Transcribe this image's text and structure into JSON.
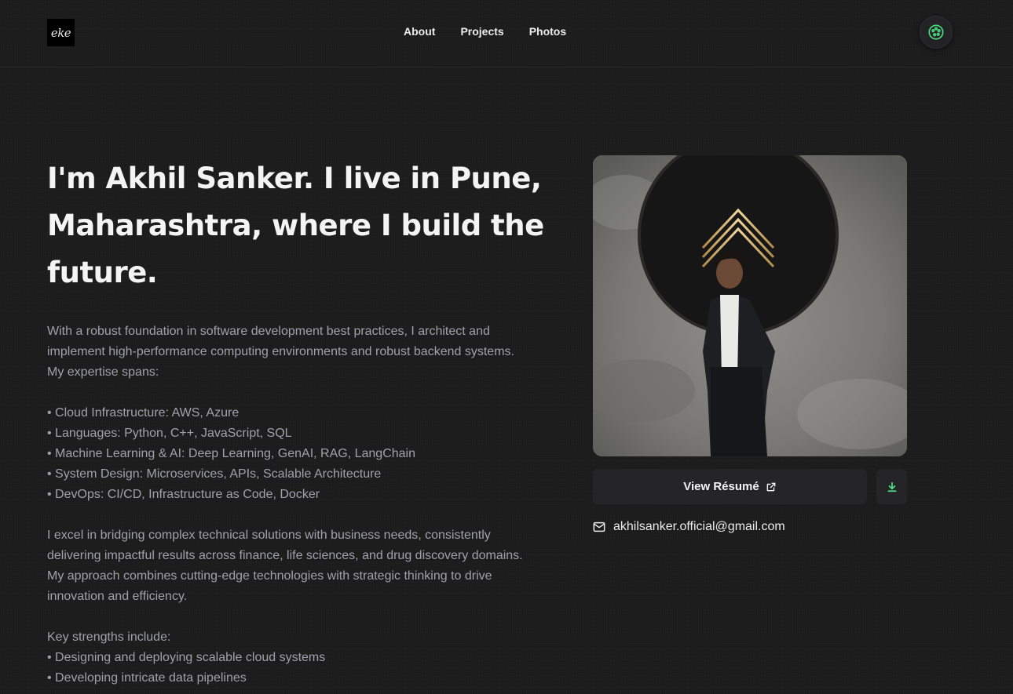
{
  "header": {
    "logo_text": "eke",
    "nav": [
      {
        "label": "About"
      },
      {
        "label": "Projects"
      },
      {
        "label": "Photos"
      }
    ],
    "theme_icon": "palette-icon",
    "accent_color": "#4ade80"
  },
  "hero": {
    "title": "I'm Akhil Sanker. I live in Pune, Maharashtra, where I build the future."
  },
  "bio": {
    "intro": "With a robust foundation in software development best practices, I architect and implement high-performance computing environments and robust backend systems. My expertise spans:",
    "expertise": [
      "• Cloud Infrastructure: AWS, Azure",
      "• Languages: Python, C++, JavaScript, SQL",
      "• Machine Learning & AI: Deep Learning, GenAI, RAG, LangChain",
      "• System Design: Microservices, APIs, Scalable Architecture",
      "• DevOps: CI/CD, Infrastructure as Code, Docker"
    ],
    "bridging": "I excel in bridging complex technical solutions with business needs, consistently delivering impactful results across finance, life sciences, and drug discovery domains. My approach combines cutting-edge technologies with strategic thinking to drive innovation and efficiency.",
    "strengths_heading": "Key strengths include:",
    "strengths": [
      "• Designing and deploying scalable cloud systems",
      "• Developing intricate data pipelines"
    ]
  },
  "sidebar": {
    "photo_icon": "portrait-photo",
    "resume_label": "View Résumé",
    "resume_icon": "external-link-icon",
    "download_icon": "download-icon",
    "email_icon": "mail-icon",
    "email": "akhilsanker.official@gmail.com"
  }
}
